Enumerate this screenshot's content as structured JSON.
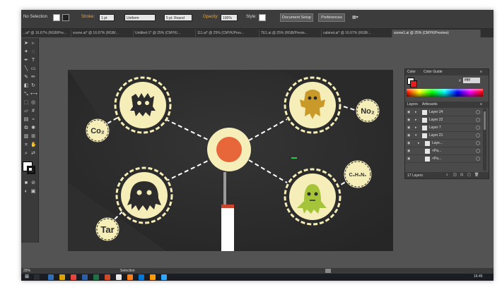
{
  "control_bar": {
    "selection_label": "No Selection",
    "stroke_label": "Stroke:",
    "stroke_weight": "1 pt",
    "profile": "Uniform",
    "brush": "5 pt. Round",
    "opacity_label": "Opacity:",
    "opacity_value": "100%",
    "style_label": "Style:",
    "document_setup": "Document Setup",
    "preferences": "Preferences"
  },
  "tabs": [
    {
      "label": "...ai* @ 16.67% (RGB/Pre..."
    },
    {
      "label": "scene.ai* @ 16.67% (RGB/..."
    },
    {
      "label": "Untitled-1* @ 25% (CMYK/..."
    },
    {
      "label": "111.ai* @ 25% (CMYK/Prev..."
    },
    {
      "label": "TE1.ai @ 25% (RGB/Previe..."
    },
    {
      "label": "cabinet.ai* @ 16.67% (RGB/..."
    },
    {
      "label": "scene1.ai @ 25% (CMYK/Preview)",
      "active": true
    }
  ],
  "artwork": {
    "labels": {
      "top_left": "Co₂",
      "top_right": "No₂",
      "bottom_left": "Tar",
      "bottom_right": "C₆H₆N₂"
    }
  },
  "panel": {
    "color_tab": "Color",
    "color_guide_tab": "Color Guide",
    "hex_value": "ffffff",
    "layers_tab": "Layers",
    "artboards_tab": "Artboards",
    "layers": [
      {
        "name": "Layer 24"
      },
      {
        "name": "Layer 22"
      },
      {
        "name": "Layer 7"
      },
      {
        "name": "Layer 21"
      },
      {
        "name": "Laye..."
      },
      {
        "name": "<Pa..."
      },
      {
        "name": "<Pa..."
      }
    ],
    "layer_count": "17 Layers"
  },
  "status": {
    "zoom": "25%",
    "tool": "Selection"
  },
  "taskbar": {
    "time": "16:45"
  },
  "colors": {
    "cream": "#f6eeb8",
    "dark": "#2c2c2c",
    "center_red": "#e8673a",
    "mustard": "#c99a2a",
    "green_monster": "#a6c43a",
    "bottom_stripe": "#c9462e"
  }
}
